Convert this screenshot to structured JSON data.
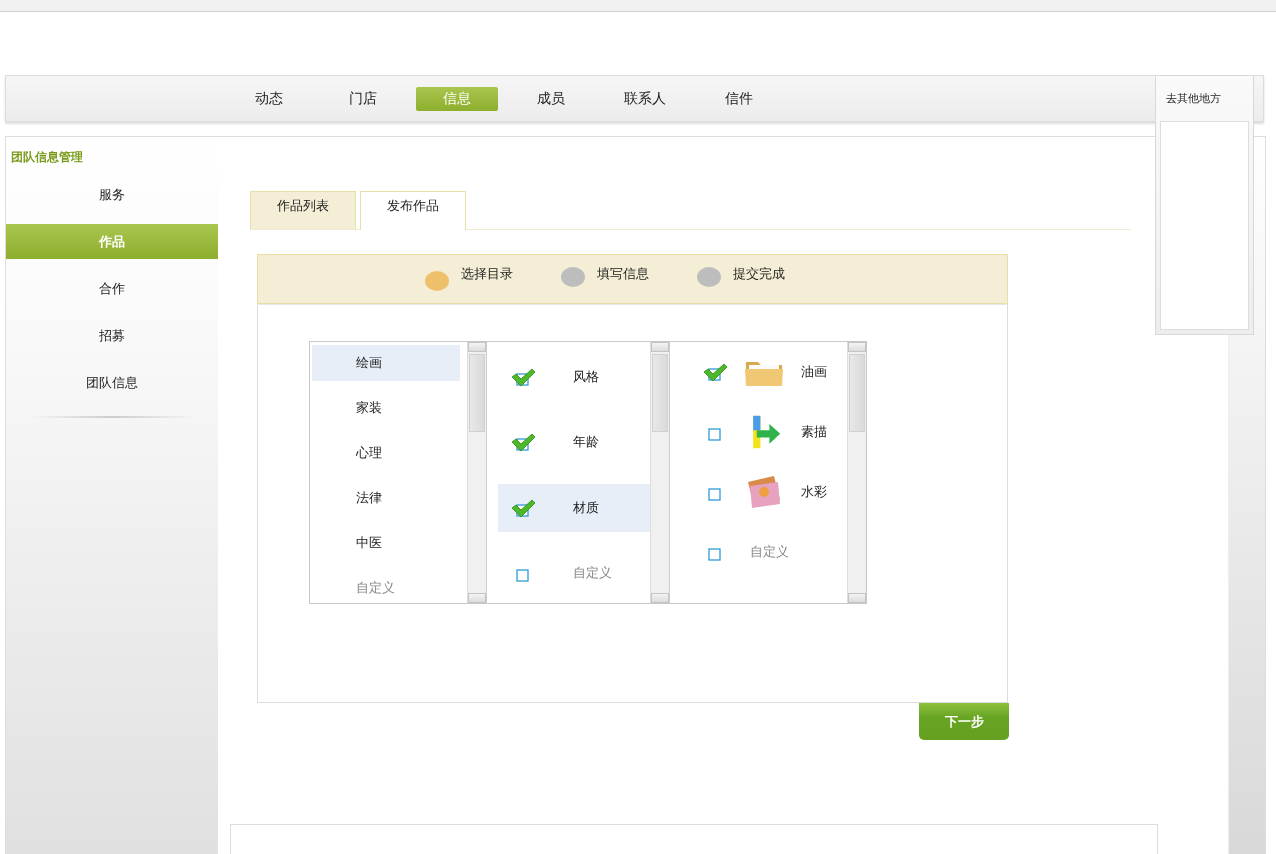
{
  "nav": [
    {
      "label": "动态",
      "selected": false
    },
    {
      "label": "门店",
      "selected": false
    },
    {
      "label": "信息",
      "selected": true
    },
    {
      "label": "成员",
      "selected": false
    },
    {
      "label": "联系人",
      "selected": false
    },
    {
      "label": "信件",
      "selected": false
    }
  ],
  "side_panel": {
    "title": "去其他地方"
  },
  "sidebar": {
    "title": "团队信息管理",
    "items": [
      {
        "label": "服务",
        "selected": false
      },
      {
        "label": "作品",
        "selected": true
      },
      {
        "label": "合作",
        "selected": false
      },
      {
        "label": "招募",
        "selected": false
      },
      {
        "label": "团队信息",
        "selected": false
      }
    ]
  },
  "tabs": [
    {
      "label": "作品列表",
      "selected": false
    },
    {
      "label": "发布作品",
      "selected": true
    }
  ],
  "steps": [
    {
      "label": "选择目录",
      "selected": true
    },
    {
      "label": "填写信息",
      "selected": false
    },
    {
      "label": "提交完成",
      "selected": false
    }
  ],
  "categories": [
    {
      "label": "绘画",
      "kind": "item",
      "selected": true
    },
    {
      "label": "家装",
      "kind": "item",
      "selected": false
    },
    {
      "label": "心理",
      "kind": "item",
      "selected": false
    },
    {
      "label": "法律",
      "kind": "item",
      "selected": false
    },
    {
      "label": "中医",
      "kind": "item",
      "selected": false
    },
    {
      "label": "自定义",
      "kind": "custom",
      "selected": false
    }
  ],
  "attributes": [
    {
      "label": "风格",
      "kind": "item",
      "checked": true,
      "selected": false
    },
    {
      "label": "年龄",
      "kind": "item",
      "checked": true,
      "selected": false
    },
    {
      "label": "材质",
      "kind": "item",
      "checked": true,
      "selected": true
    },
    {
      "label": "自定义",
      "kind": "custom",
      "checked": false,
      "selected": false
    }
  ],
  "options": [
    {
      "label": "油画",
      "kind": "item",
      "checked": true
    },
    {
      "label": "素描",
      "kind": "item",
      "checked": false
    },
    {
      "label": "水彩",
      "kind": "item",
      "checked": false
    },
    {
      "label": "自定义",
      "kind": "custom",
      "checked": false
    }
  ],
  "next_button": "下一步"
}
